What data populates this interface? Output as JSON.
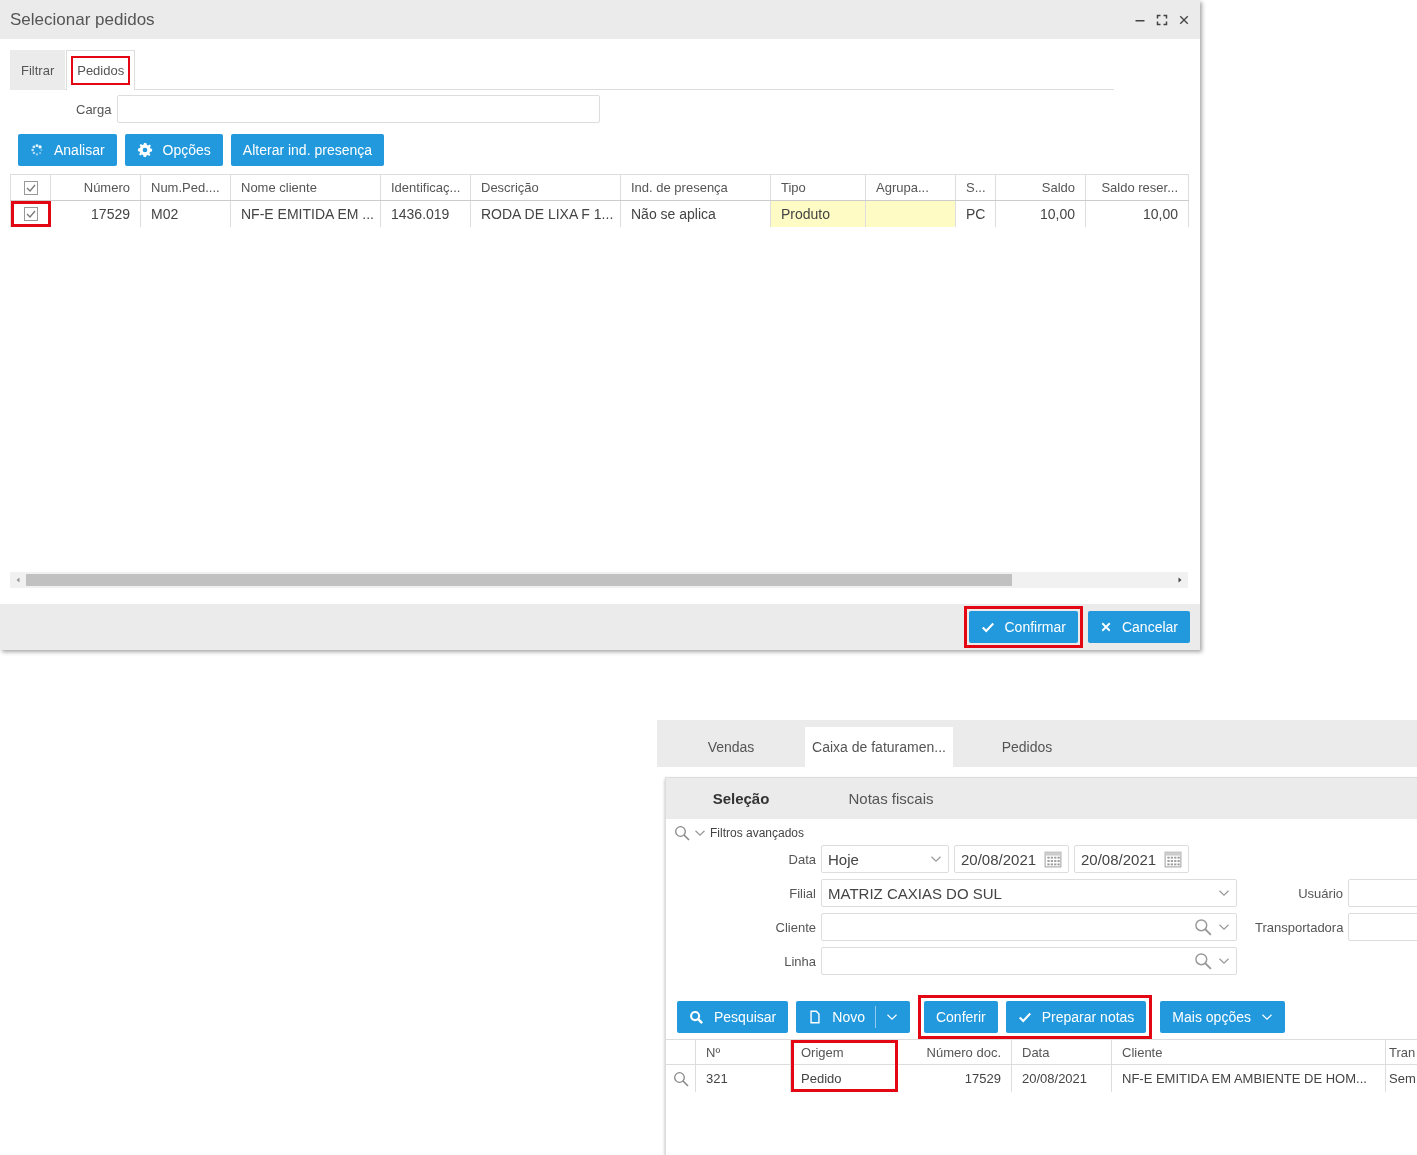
{
  "dialog": {
    "title": "Selecionar pedidos",
    "tabs": [
      {
        "label": "Filtrar",
        "selected": false,
        "highlighted": false
      },
      {
        "label": "Pedidos",
        "selected": true,
        "highlighted": true
      }
    ],
    "carga": {
      "label": "Carga"
    },
    "toolbar": [
      {
        "label": "Analisar",
        "kind": "spinner"
      },
      {
        "label": "Opções",
        "kind": "gear"
      },
      {
        "label": "Alterar ind. presença",
        "kind": "plain"
      }
    ],
    "table": {
      "header_checked": true,
      "columns": [
        {
          "label": "Número",
          "kind": "number",
          "editable": false
        },
        {
          "label": "Num.Ped....",
          "kind": "text",
          "editable": false
        },
        {
          "label": "Nome cliente",
          "kind": "text",
          "editable": false
        },
        {
          "label": "Identificaç...",
          "kind": "text",
          "editable": false
        },
        {
          "label": "Descrição",
          "kind": "text",
          "editable": false
        },
        {
          "label": "Ind. de presença",
          "kind": "text",
          "editable": false
        },
        {
          "label": "Tipo",
          "kind": "text",
          "editable": true
        },
        {
          "label": "Agrupa...",
          "kind": "text",
          "editable": true
        },
        {
          "label": "S...",
          "kind": "text",
          "editable": false
        },
        {
          "label": "Saldo",
          "kind": "number",
          "editable": false
        },
        {
          "label": "Saldo reser...",
          "kind": "number",
          "editable": false
        }
      ],
      "rows": [
        {
          "checked": true,
          "highlighted": true,
          "cells": [
            "17529",
            "M02",
            "NF-E EMITIDA EM ...",
            "1436.019",
            "RODA DE LIXA F 1...",
            "Não se aplica",
            "Produto",
            "",
            "PC",
            "10,00",
            "10,00"
          ]
        }
      ]
    },
    "footer": [
      {
        "label": "Confirmar",
        "kind": "confirm",
        "highlighted": true
      },
      {
        "label": "Cancelar",
        "kind": "cancel",
        "highlighted": false
      }
    ]
  },
  "billing": {
    "tabs": [
      {
        "label": "Vendas",
        "selected": false
      },
      {
        "label": "Caixa de faturamen...",
        "selected": true
      },
      {
        "label": "Pedidos",
        "selected": false
      }
    ],
    "subtabs": [
      {
        "label": "Seleção",
        "selected": true
      },
      {
        "label": "Notas fiscais",
        "selected": false
      }
    ],
    "filter_toggle": "Filtros avançados",
    "fields": [
      {
        "label": "Data",
        "kind": "date-range",
        "value": "Hoje",
        "from": "20/08/2021",
        "to": "20/08/2021"
      },
      {
        "label": "Filial",
        "kind": "select",
        "value": "MATRIZ CAXIAS DO SUL"
      },
      {
        "label": "Cliente",
        "kind": "lookup"
      },
      {
        "label": "Linha",
        "kind": "lookup"
      }
    ],
    "side_fields": [
      {
        "label": "Usuário"
      },
      {
        "label": "Transportadora"
      }
    ],
    "toolbar": [
      {
        "highlighted": false,
        "buttons": [
          {
            "label": "Pesquisar",
            "kind": "search"
          },
          {
            "label": "Novo",
            "kind": "split"
          }
        ]
      },
      {
        "highlighted": true,
        "buttons": [
          {
            "label": "Conferir",
            "kind": "plain"
          },
          {
            "label": "Preparar notas",
            "kind": "check"
          }
        ]
      },
      {
        "highlighted": false,
        "buttons": [
          {
            "label": "Mais opções",
            "kind": "menu"
          }
        ]
      }
    ],
    "table": {
      "columns": [
        {
          "label": "Nº",
          "kind": "text",
          "highlighted": false
        },
        {
          "label": "Origem",
          "kind": "text",
          "highlighted": true
        },
        {
          "label": "Número doc.",
          "kind": "number",
          "highlighted": false
        },
        {
          "label": "Data",
          "kind": "text",
          "highlighted": false
        },
        {
          "label": "Cliente",
          "kind": "text",
          "highlighted": false
        },
        {
          "label": "Tran",
          "kind": "text",
          "highlighted": false
        }
      ],
      "rows": [
        {
          "cells": [
            "321",
            "Pedido",
            "17529",
            "20/08/2021",
            "NF-E EMITIDA EM AMBIENTE DE HOM...",
            "Sem"
          ]
        }
      ]
    }
  }
}
